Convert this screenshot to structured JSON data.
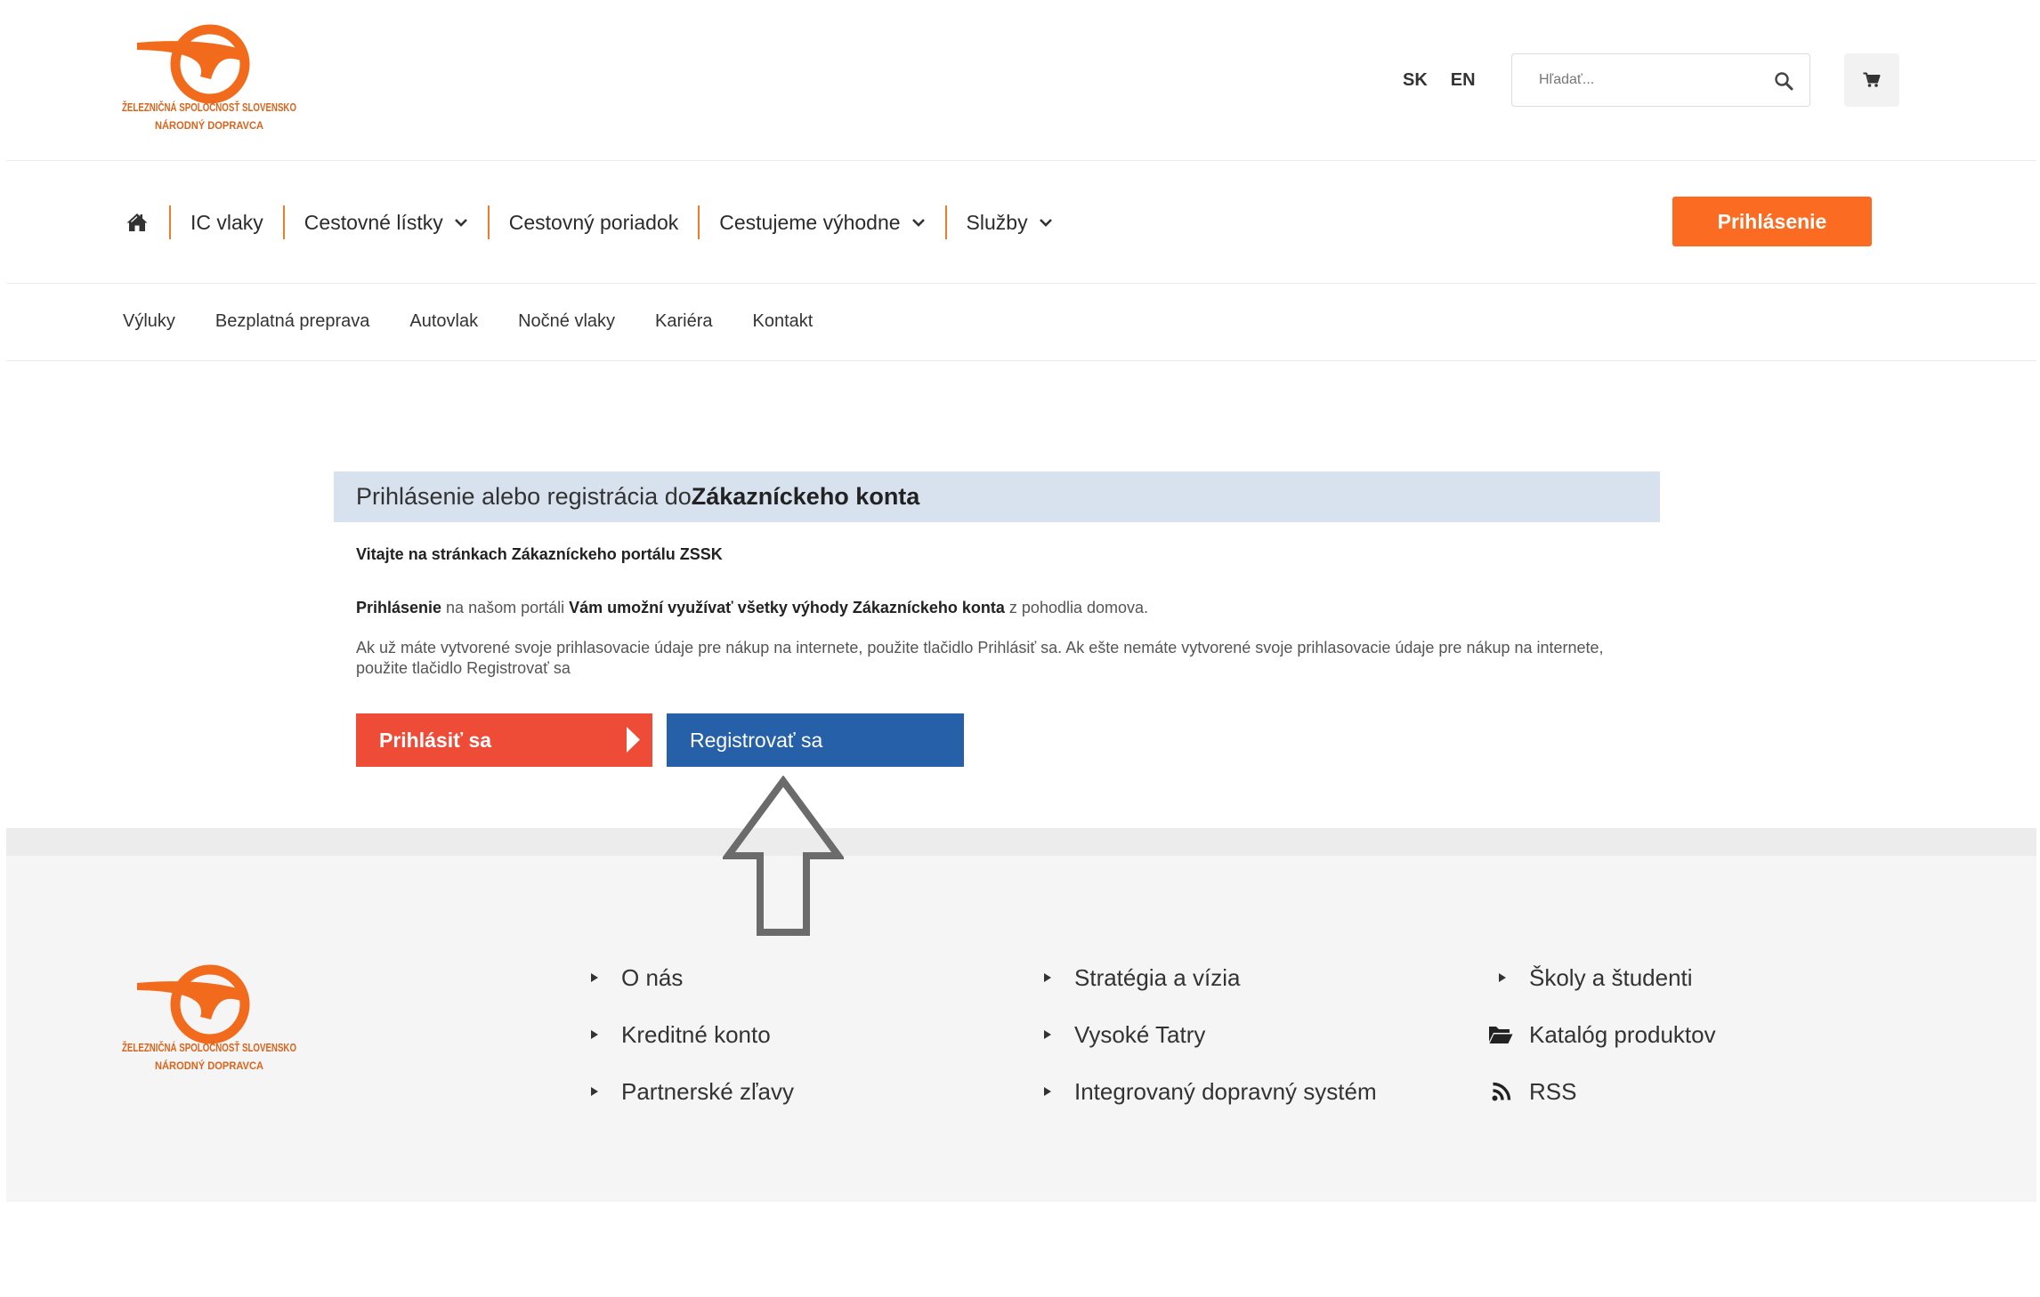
{
  "logo": {
    "line1": "ŽELEZNIČNÁ SPOLOČNOSŤ SLOVENSKO",
    "line2": "NÁRODNÝ DOPRAVCA"
  },
  "header": {
    "languages": [
      "SK",
      "EN"
    ],
    "search": {
      "placeholder": "Hľadať...",
      "icon": "search-icon"
    },
    "cart": {
      "icon": "cart-icon"
    }
  },
  "nav": {
    "home_icon": "home-icon",
    "dropdown_icon": "chevron-down-icon",
    "items": [
      {
        "label": "IC vlaky",
        "dropdown": false
      },
      {
        "label": "Cestovné lístky",
        "dropdown": true
      },
      {
        "label": "Cestovný poriadok",
        "dropdown": false
      },
      {
        "label": "Cestujeme výhodne",
        "dropdown": true
      },
      {
        "label": "Služby",
        "dropdown": true
      }
    ],
    "login_label": "Prihlásenie"
  },
  "subnav": {
    "items": [
      "Výluky",
      "Bezplatná preprava",
      "Autovlak",
      "Nočné vlaky",
      "Kariéra",
      "Kontakt"
    ]
  },
  "login_panel": {
    "title_prefix": "Prihlásenie alebo registrácia do ",
    "title_bold": "Zákazníckeho konta",
    "welcome": "Vitajte na stránkach Zákazníckeho portálu ZSSK",
    "intro": {
      "part1_bold": "Prihlásenie",
      "part2": " na našom portáli ",
      "part3_bold": "Vám umožní využívať všetky výhody Zákazníckeho konta",
      "part4": " z pohodlia domova."
    },
    "instructions": "Ak už máte vytvorené svoje prihlasovacie údaje pre nákup na internete, použite tlačidlo Prihlásiť sa. Ak ešte nemáte vytvorené svoje prihlasovacie údaje pre nákup na internete, použite tlačidlo Registrovať sa",
    "login_button": "Prihlásiť sa",
    "login_button_icon": "play-right-icon",
    "register_button": "Registrovať sa"
  },
  "annotation": {
    "icon": "arrow-up-outline-icon"
  },
  "footer": {
    "columns": [
      [
        {
          "label": "O nás",
          "icon": "bullet-icon"
        },
        {
          "label": "Kreditné konto",
          "icon": "bullet-icon"
        },
        {
          "label": "Partnerské zľavy",
          "icon": "bullet-icon"
        }
      ],
      [
        {
          "label": "Stratégia a vízia",
          "icon": "bullet-icon"
        },
        {
          "label": "Vysoké Tatry",
          "icon": "bullet-icon"
        },
        {
          "label": "Integrovaný dopravný systém",
          "icon": "bullet-icon"
        }
      ],
      [
        {
          "label": "Školy a študenti",
          "icon": "bullet-icon"
        },
        {
          "label": "Katalóg produktov",
          "icon": "folder-icon"
        },
        {
          "label": "RSS",
          "icon": "rss-icon"
        }
      ]
    ]
  },
  "colors": {
    "brand_orange": "#fc6b22",
    "nav_separator": "#f07c2b",
    "login_red": "#ef4c37",
    "register_blue": "#2660a8",
    "panel_header_bg": "#d7e2ee",
    "footer_bg": "#f5f5f5",
    "annotation_gray": "#6b6b6b"
  }
}
